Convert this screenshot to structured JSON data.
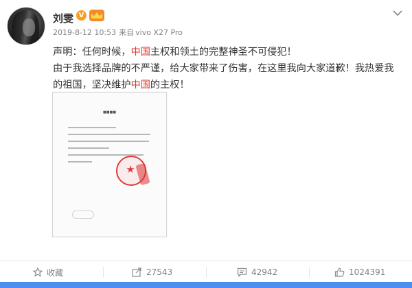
{
  "post": {
    "author": "刘雯",
    "badge_v": "V",
    "timestamp": "2019-8-12 10:53",
    "source_label": "来自",
    "source_device": "vivo X27 Pro",
    "lines": [
      {
        "parts": [
          {
            "text": "声明：任何时候，",
            "color": "normal"
          },
          {
            "text": "中国",
            "color": "red"
          },
          {
            "text": "主权和领土的完整神圣不可侵犯！",
            "color": "normal"
          }
        ]
      },
      {
        "parts": [
          {
            "text": "由于我选择品牌的不严谨，给大家带来了伤害，在这里我向大家道歉！我热爱我",
            "color": "normal"
          }
        ]
      },
      {
        "parts": [
          {
            "text": "的祖国，坚决维护",
            "color": "red_skip"
          },
          {
            "text": "中国",
            "color": "red"
          },
          {
            "text": "的主权！",
            "color": "normal"
          }
        ]
      }
    ],
    "attached_image": {
      "icon": "document-statement-image"
    }
  },
  "actions": {
    "collect_label": "收藏",
    "repost_count": "27543",
    "comment_count": "42942",
    "like_count": "1024391"
  },
  "colors": {
    "accent_red": "#e0332a",
    "text": "#333333",
    "muted": "#808080",
    "vip_orange": "#f7a01a",
    "bottom_blue": "#4c8ff0"
  }
}
